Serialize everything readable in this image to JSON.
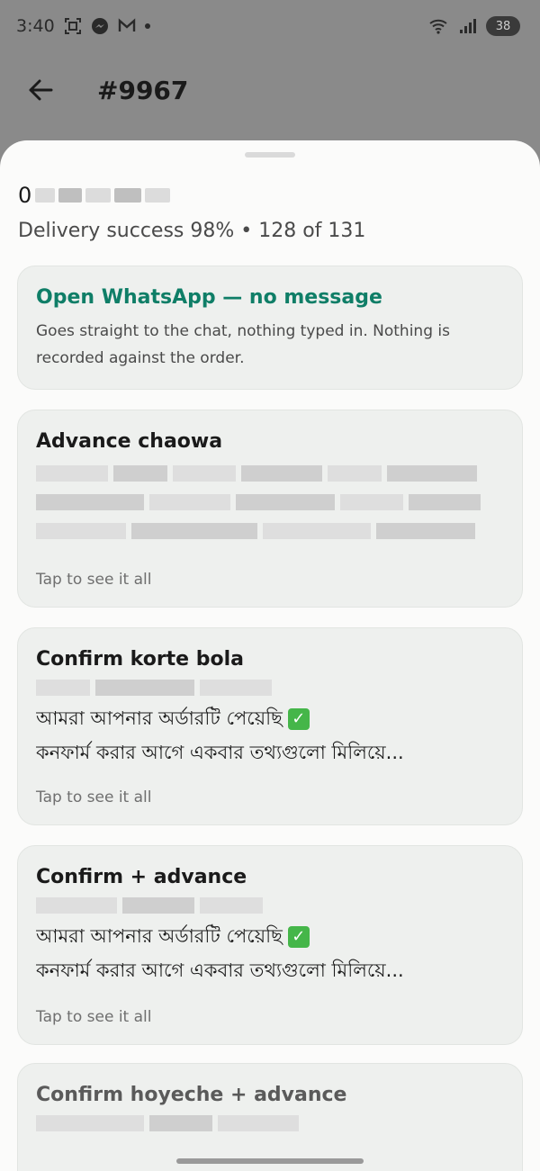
{
  "status_bar": {
    "time": "3:40",
    "battery": "38",
    "icons": [
      "screenshot-icon",
      "messenger-icon",
      "gmail-icon",
      "notification-dot",
      "wifi-icon",
      "signal-icon",
      "battery-icon"
    ]
  },
  "app_bar": {
    "title": "#9967",
    "back_icon": "arrow-left-icon"
  },
  "sheet": {
    "contact_initial": "0",
    "delivery_stats": "Delivery success 98% • 128 of 131",
    "cards": [
      {
        "title": "Open WhatsApp — no message",
        "description": "Goes straight to the chat, nothing typed in. Nothing is recorded against the order."
      },
      {
        "title": "Advance chaowa",
        "hint": "Tap to see it all"
      },
      {
        "title": "Confirm korte bola",
        "body_line1": "আমরা আপনার অর্ডারটি পেয়েছি",
        "body_line2": "কনফার্ম করার আগে একবার তথ্যগুলো মিলিয়ে...",
        "hint": "Tap to see it all"
      },
      {
        "title": "Confirm + advance",
        "body_line1": "আমরা আপনার অর্ডারটি পেয়েছি",
        "body_line2": "কনফার্ম করার আগে একবার তথ্যগুলো মিলিয়ে...",
        "hint": "Tap to see it all"
      },
      {
        "title": "Confirm hoyeche + advance"
      }
    ]
  },
  "colors": {
    "accent": "#0f7e67",
    "sheet_bg": "#fbfbfa",
    "card_bg": "#eef0ee",
    "scrim": "#8a8a8a"
  }
}
